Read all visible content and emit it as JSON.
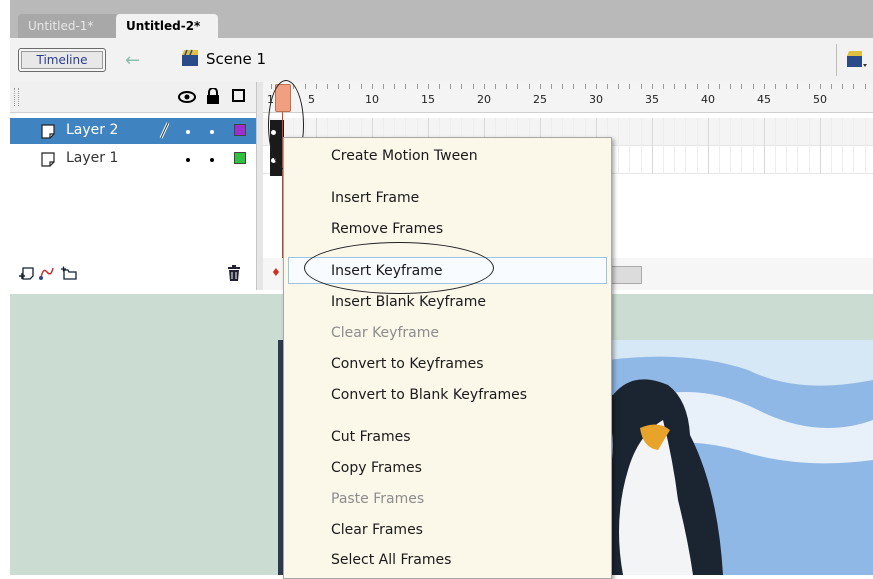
{
  "tabs": [
    {
      "label": "Untitled-1*",
      "active": false
    },
    {
      "label": "Untitled-2*",
      "active": true
    }
  ],
  "toolbar": {
    "timeline_label": "Timeline",
    "scene_label": "Scene 1"
  },
  "layers": [
    {
      "name": "Layer 2",
      "selected": true,
      "color": "#9b30d0"
    },
    {
      "name": "Layer 1",
      "selected": false,
      "color": "#30c040"
    }
  ],
  "ruler": {
    "marks": [
      "1",
      "5",
      "10",
      "15",
      "20",
      "25",
      "30",
      "35",
      "40",
      "45",
      "50"
    ]
  },
  "context_menu": {
    "items": [
      {
        "label": "Create Motion Tween",
        "enabled": true
      },
      {
        "label": "Insert Frame",
        "enabled": true
      },
      {
        "label": "Remove Frames",
        "enabled": true
      },
      {
        "label": "Insert Keyframe",
        "enabled": true,
        "highlighted": true
      },
      {
        "label": "Insert Blank Keyframe",
        "enabled": true
      },
      {
        "label": "Clear Keyframe",
        "enabled": false
      },
      {
        "label": "Convert to Keyframes",
        "enabled": true
      },
      {
        "label": "Convert to Blank Keyframes",
        "enabled": true
      },
      {
        "label": "Cut Frames",
        "enabled": true
      },
      {
        "label": "Copy Frames",
        "enabled": true
      },
      {
        "label": "Paste Frames",
        "enabled": false
      },
      {
        "label": "Clear Frames",
        "enabled": true
      },
      {
        "label": "Select All Frames",
        "enabled": true
      }
    ]
  },
  "colors": {
    "selection_blue": "#3f83c0",
    "menu_bg": "#fbf7e9",
    "stage_bg": "#cbddd3",
    "playhead": "#d0452a"
  }
}
